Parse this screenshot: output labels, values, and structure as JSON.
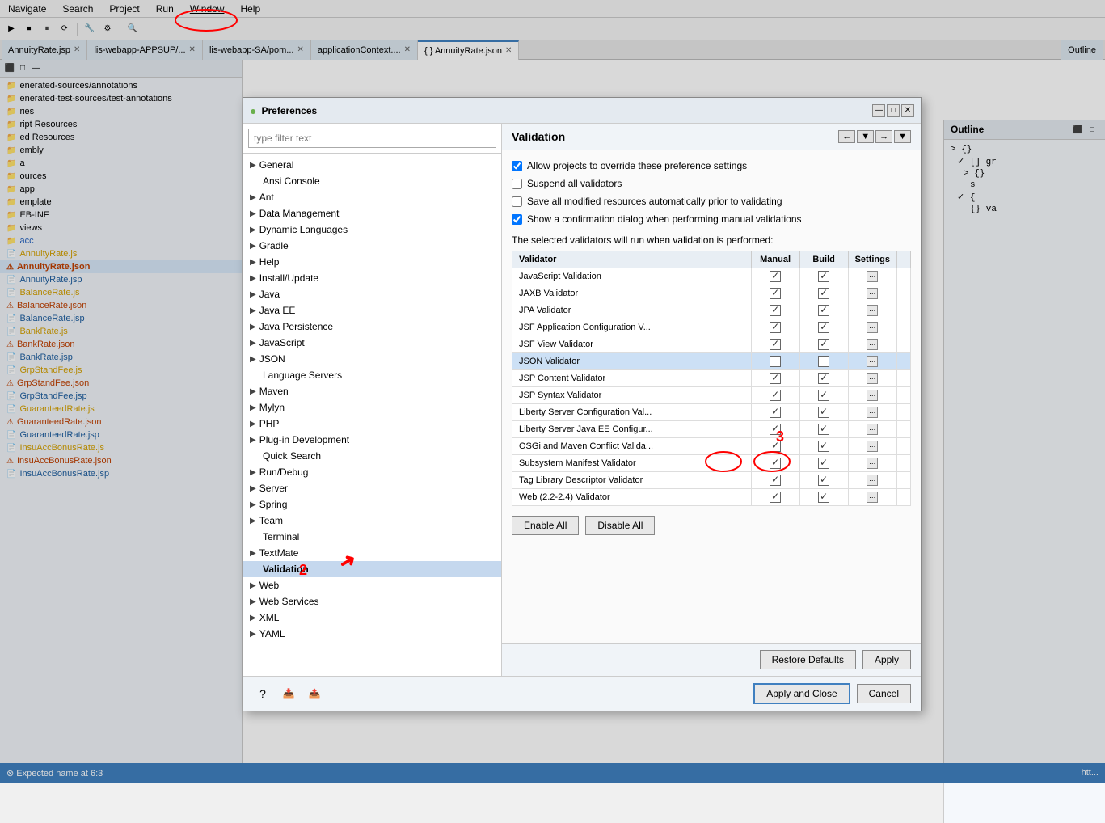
{
  "menu": {
    "items": [
      "Navigate",
      "Search",
      "Project",
      "Run",
      "Window",
      "Help"
    ]
  },
  "tabs": [
    {
      "label": "AnnuityRate.jsp",
      "active": false
    },
    {
      "label": "lis-webapp-APPSUP/...",
      "active": false
    },
    {
      "label": "lis-webapp-SA/pom...",
      "active": false
    },
    {
      "label": "applicationContext....",
      "active": false
    },
    {
      "label": "{ } AnnuityRate.json",
      "active": true
    },
    {
      "label": "Outline",
      "active": false
    }
  ],
  "left_panel": {
    "files": [
      {
        "name": "enerated-sources/annotations",
        "type": "folder"
      },
      {
        "name": "enerated-test-sources/test-annotations",
        "type": "folder"
      },
      {
        "name": "ries",
        "type": "folder"
      },
      {
        "name": "ript Resources",
        "type": "folder"
      },
      {
        "name": "ed Resources",
        "type": "folder"
      },
      {
        "name": "embly",
        "type": "folder"
      },
      {
        "name": "a",
        "type": "folder"
      },
      {
        "name": "ources",
        "type": "folder"
      },
      {
        "name": "app",
        "type": "folder"
      },
      {
        "name": "emplate",
        "type": "folder"
      },
      {
        "name": "EB-INF",
        "type": "folder"
      },
      {
        "name": "views",
        "type": "folder"
      },
      {
        "name": "acc",
        "type": "folder"
      },
      {
        "name": "AnnuityRate.js",
        "type": "js"
      },
      {
        "name": "AnnuityRate.json",
        "type": "json",
        "selected": true
      },
      {
        "name": "AnnuityRate.jsp",
        "type": "jsp"
      },
      {
        "name": "BalanceRate.js",
        "type": "js"
      },
      {
        "name": "BalanceRate.json",
        "type": "json"
      },
      {
        "name": "BalanceRate.jsp",
        "type": "jsp"
      },
      {
        "name": "BankRate.js",
        "type": "js"
      },
      {
        "name": "BankRate.json",
        "type": "json"
      },
      {
        "name": "BankRate.jsp",
        "type": "jsp"
      },
      {
        "name": "GrpStandFee.js",
        "type": "js"
      },
      {
        "name": "GrpStandFee.json",
        "type": "json"
      },
      {
        "name": "GrpStandFee.jsp",
        "type": "jsp"
      },
      {
        "name": "GuaranteedRate.js",
        "type": "js"
      },
      {
        "name": "GuaranteedRate.json",
        "type": "json"
      },
      {
        "name": "GuaranteedRate.jsp",
        "type": "jsp"
      },
      {
        "name": "InsuAccBonusRate.js",
        "type": "js"
      },
      {
        "name": "InsuAccBonusRate.json",
        "type": "json"
      },
      {
        "name": "InsuAccBonusRate.jsp",
        "type": "jsp"
      }
    ]
  },
  "dialog": {
    "title": "Preferences",
    "filter_placeholder": "type filter text",
    "tree": [
      {
        "label": "General",
        "level": 0,
        "arrow": "▶"
      },
      {
        "label": "Ansi Console",
        "level": 1,
        "arrow": ""
      },
      {
        "label": "Ant",
        "level": 0,
        "arrow": "▶"
      },
      {
        "label": "Data Management",
        "level": 0,
        "arrow": "▶"
      },
      {
        "label": "Dynamic Languages",
        "level": 0,
        "arrow": "▶"
      },
      {
        "label": "Gradle",
        "level": 0,
        "arrow": "▶"
      },
      {
        "label": "Help",
        "level": 0,
        "arrow": "▶"
      },
      {
        "label": "Install/Update",
        "level": 0,
        "arrow": "▶"
      },
      {
        "label": "Java",
        "level": 0,
        "arrow": "▶"
      },
      {
        "label": "Java EE",
        "level": 0,
        "arrow": "▶"
      },
      {
        "label": "Java Persistence",
        "level": 0,
        "arrow": "▶"
      },
      {
        "label": "JavaScript",
        "level": 0,
        "arrow": "▶"
      },
      {
        "label": "JSON",
        "level": 0,
        "arrow": "▶"
      },
      {
        "label": "Language Servers",
        "level": 0,
        "arrow": ""
      },
      {
        "label": "Maven",
        "level": 0,
        "arrow": "▶"
      },
      {
        "label": "Mylyn",
        "level": 0,
        "arrow": "▶"
      },
      {
        "label": "PHP",
        "level": 0,
        "arrow": "▶"
      },
      {
        "label": "Plug-in Development",
        "level": 0,
        "arrow": "▶"
      },
      {
        "label": "Quick Search",
        "level": 0,
        "arrow": ""
      },
      {
        "label": "Run/Debug",
        "level": 0,
        "arrow": "▶"
      },
      {
        "label": "Server",
        "level": 0,
        "arrow": "▶"
      },
      {
        "label": "Spring",
        "level": 0,
        "arrow": "▶"
      },
      {
        "label": "Team",
        "level": 0,
        "arrow": "▶"
      },
      {
        "label": "Terminal",
        "level": 0,
        "arrow": ""
      },
      {
        "label": "TextMate",
        "level": 0,
        "arrow": "▶"
      },
      {
        "label": "Validation",
        "level": 0,
        "arrow": "",
        "selected": true
      },
      {
        "label": "Web",
        "level": 0,
        "arrow": "▶"
      },
      {
        "label": "Web Services",
        "level": 0,
        "arrow": "▶"
      },
      {
        "label": "XML",
        "level": 0,
        "arrow": "▶"
      },
      {
        "label": "YAML",
        "level": 0,
        "arrow": "▶"
      }
    ],
    "content": {
      "title": "Validation",
      "checkboxes": [
        {
          "label": "Allow projects to override these preference settings",
          "checked": true
        },
        {
          "label": "Suspend all validators",
          "checked": false
        },
        {
          "label": "Save all modified resources automatically prior to validating",
          "checked": false
        },
        {
          "label": "Show a confirmation dialog when performing manual validations",
          "checked": true
        }
      ],
      "validators_label": "The selected validators will run when validation is performed:",
      "table_headers": [
        "Validator",
        "Manual",
        "Build",
        "Settings"
      ],
      "validators": [
        {
          "name": "JavaScript Validation",
          "manual": true,
          "build": true,
          "settings": true,
          "selected": false
        },
        {
          "name": "JAXB Validator",
          "manual": true,
          "build": true,
          "settings": true,
          "selected": false
        },
        {
          "name": "JPA Validator",
          "manual": true,
          "build": true,
          "settings": true,
          "selected": false
        },
        {
          "name": "JSF Application Configuration V...",
          "manual": true,
          "build": true,
          "settings": true,
          "selected": false
        },
        {
          "name": "JSF View Validator",
          "manual": true,
          "build": true,
          "settings": true,
          "selected": false
        },
        {
          "name": "JSON Validator",
          "manual": false,
          "build": false,
          "settings": true,
          "selected": true
        },
        {
          "name": "JSP Content Validator",
          "manual": true,
          "build": true,
          "settings": true,
          "selected": false
        },
        {
          "name": "JSP Syntax Validator",
          "manual": true,
          "build": true,
          "settings": true,
          "selected": false
        },
        {
          "name": "Liberty Server Configuration Val...",
          "manual": true,
          "build": true,
          "settings": true,
          "selected": false
        },
        {
          "name": "Liberty Server Java EE Configur...",
          "manual": true,
          "build": true,
          "settings": true,
          "selected": false
        },
        {
          "name": "OSGi and Maven Conflict Valida...",
          "manual": true,
          "build": true,
          "settings": true,
          "selected": false
        },
        {
          "name": "Subsystem Manifest Validator",
          "manual": true,
          "build": true,
          "settings": true,
          "selected": false
        },
        {
          "name": "Tag Library Descriptor Validator",
          "manual": true,
          "build": true,
          "settings": true,
          "selected": false
        },
        {
          "name": "Web (2.2-2.4) Validator",
          "manual": true,
          "build": true,
          "settings": false,
          "selected": false
        }
      ],
      "buttons": {
        "enable_all": "Enable All",
        "disable_all": "Disable All",
        "restore_defaults": "Restore Defaults",
        "apply": "Apply"
      }
    },
    "footer": {
      "apply_close": "Apply and Close",
      "cancel": "Cancel"
    }
  },
  "outline": {
    "title": "Outline",
    "content": [
      "> {}",
      "  ✓ [] gr",
      "    > {}",
      "      s",
      "  ✓ {"
    ]
  },
  "status_bar": {
    "message": "⊗ Expected name at 6:3",
    "right": "htt..."
  }
}
